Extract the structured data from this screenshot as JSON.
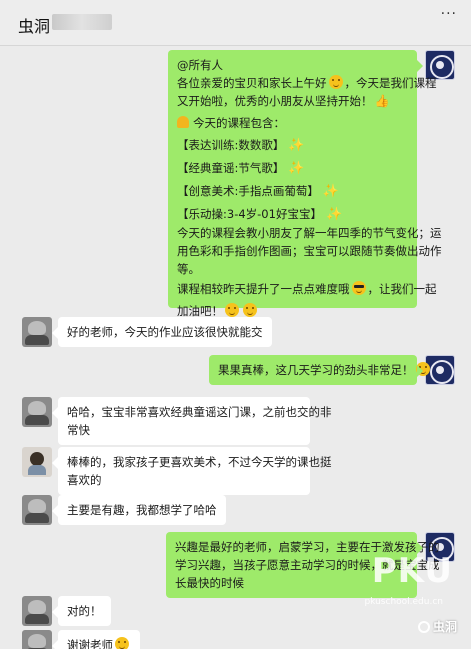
{
  "header": {
    "title": "虫洞",
    "more_icon": "more-icon"
  },
  "messages": [
    {
      "side": "right",
      "lines": [
        "@所有人",
        "各位亲爱的宝贝和家长上午好",
        "，今天是我们课程",
        "又开始啦，优秀的小朋友从坚持开始！",
        "今天的课程包含：",
        "【表达训练:数数歌】",
        "【经典童谣:节气歌】",
        "【创意美术:手指点画葡萄】",
        "【乐动操:3-4岁-01好宝宝】",
        "今天的课程会教小朋友了解一年四季的节气变化；运",
        "用色彩和手指创作图画；宝宝可以跟随节奏做出动作",
        "等。",
        "课程相较昨天提升了一点点难度哦",
        "，让我们一起",
        "加油吧！"
      ]
    },
    {
      "side": "left",
      "text": "好的老师，今天的作业应该很快就能交"
    },
    {
      "side": "right",
      "text": "果果真棒，这几天学习的劲头非常足！"
    },
    {
      "side": "left",
      "lines": [
        "哈哈，宝宝非常喜欢经典童谣这门课，之前也交的非",
        "常快"
      ]
    },
    {
      "side": "left",
      "lines": [
        "棒棒的，我家孩子更喜欢美术，不过今天学的课也挺",
        "喜欢的"
      ]
    },
    {
      "side": "left",
      "text": "主要是有趣，我都想学了哈哈"
    },
    {
      "side": "right",
      "lines": [
        "兴趣是最好的老师，启蒙学习，主要在于激发孩子的",
        "学习兴趣，当孩子愿意主动学习的时候，就是宝宝成",
        "长最快的时候"
      ]
    },
    {
      "side": "left",
      "text": "对的！"
    },
    {
      "side": "left",
      "text": "谢谢老师"
    }
  ],
  "watermark": {
    "text": "PKU",
    "sub": "pkuschool.edu.cn"
  },
  "brand": {
    "label": "虫洞"
  },
  "colors": {
    "self_bubble": "#9eea6a",
    "other_bubble": "#ffffff",
    "background": "#ebebeb"
  }
}
